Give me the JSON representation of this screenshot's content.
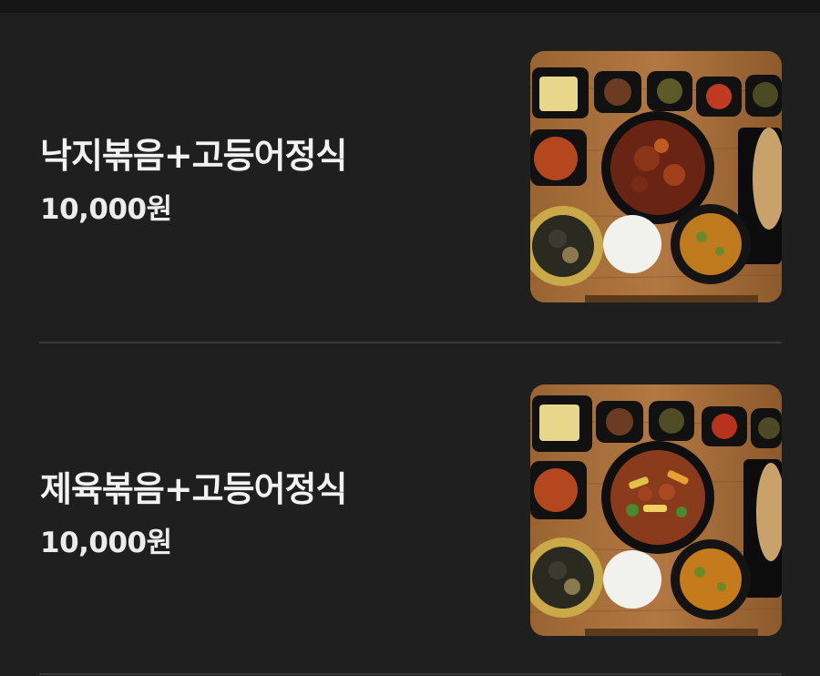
{
  "menu": {
    "items": [
      {
        "name": "낙지볶음+고등어정식",
        "price": "10,000원",
        "image": "octopus-set-photo"
      },
      {
        "name": "제육볶음+고등어정식",
        "price": "10,000원",
        "image": "pork-set-photo"
      }
    ]
  },
  "colors": {
    "background": "#1f1f1f",
    "text": "#f2f2f2",
    "divider": "#3a3a3a"
  }
}
